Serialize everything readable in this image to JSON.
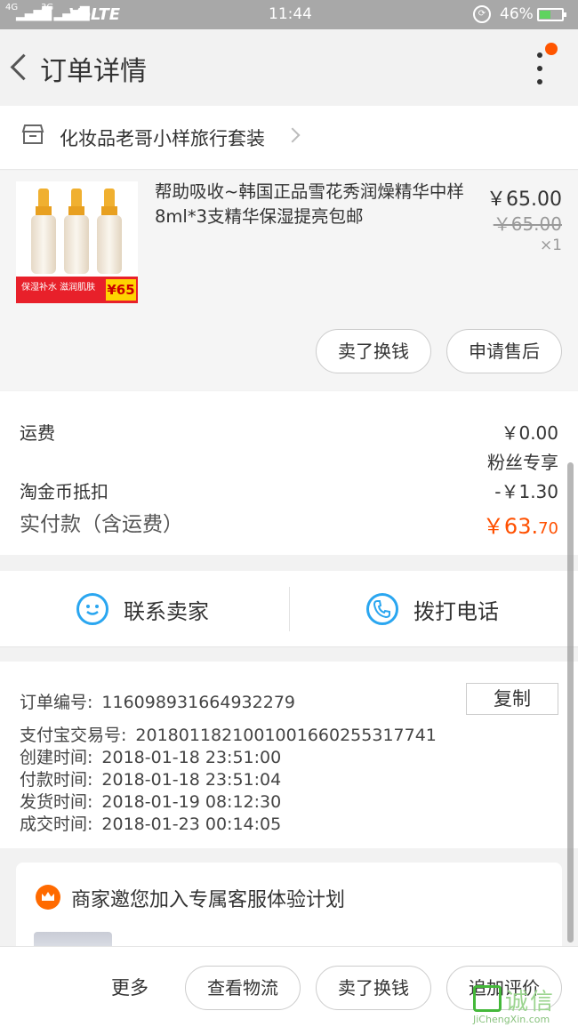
{
  "status_bar": {
    "signal_left": "4G",
    "signal_right": "3G",
    "network": "VoLTE",
    "time": "11:44",
    "battery_pct": "46%",
    "battery_level": 0.46
  },
  "header": {
    "title": "订单详情"
  },
  "shop": {
    "name": "化妆品老哥小样旅行套装"
  },
  "item": {
    "title": "帮助吸收~韩国正品雪花秀润燥精华中样8ml*3支精华保湿提亮包邮",
    "price": "￥65.00",
    "original_price": "￥65.00",
    "quantity": "×1",
    "thumb_text": "保湿补水 滋润肌肤",
    "thumb_price": "¥65",
    "buttons": [
      "卖了换钱",
      "申请售后"
    ]
  },
  "costs": {
    "shipping_label": "运费",
    "shipping_value": "￥0.00",
    "fan_badge": "粉丝专享",
    "coin_label": "淘金币抵扣",
    "coin_value": "-￥1.30",
    "paid_label": "实付款（含运费）",
    "paid_value_main": "￥63.",
    "paid_value_dec": "70",
    "accent_color": "#ff5000"
  },
  "contact": {
    "seller_label": "联系卖家",
    "seller_icon": "chat-smile-icon",
    "phone_label": "拨打电话",
    "phone_icon": "phone-icon"
  },
  "order_info": {
    "copy_label": "复制",
    "rows": [
      {
        "key": "订单编号:",
        "value": "116098931664932279"
      },
      {
        "key": "支付宝交易号:",
        "value": "2018011821001001660255317741"
      },
      {
        "key": "创建时间:",
        "value": "2018-01-18 23:51:00"
      },
      {
        "key": "付款时间:",
        "value": "2018-01-18 23:51:04"
      },
      {
        "key": "发货时间:",
        "value": "2018-01-19 08:12:30"
      },
      {
        "key": "成交时间:",
        "value": "2018-01-23 00:14:05"
      }
    ]
  },
  "promo": {
    "title": "商家邀您加入专属客服体验计划"
  },
  "bottom_bar": {
    "more": "更多",
    "buttons": [
      "查看物流",
      "卖了换钱",
      "追加评价"
    ]
  },
  "watermark": {
    "text": "诚信",
    "url": "JiChengXin.com"
  }
}
